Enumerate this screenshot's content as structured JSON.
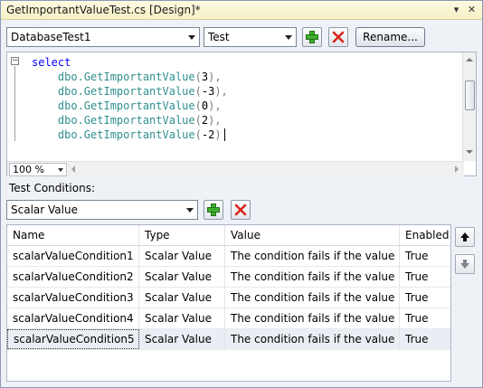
{
  "window": {
    "title": "GetImportantValueTest.cs [Design]*",
    "pin_glyph": "▾",
    "close_glyph": "✕"
  },
  "toolbar": {
    "test_select": "DatabaseTest1",
    "script_select": "Test",
    "rename_label": "Rename..."
  },
  "editor": {
    "lines": [
      {
        "kw": "select",
        "fn": "",
        "open": "",
        "num": "",
        "close": ""
      },
      {
        "kw": "",
        "fn": "dbo.GetImportantValue",
        "open": "(",
        "num": "3",
        "close": "),"
      },
      {
        "kw": "",
        "fn": "dbo.GetImportantValue",
        "open": "(",
        "num": "-3",
        "close": "),"
      },
      {
        "kw": "",
        "fn": "dbo.GetImportantValue",
        "open": "(",
        "num": "0",
        "close": "),"
      },
      {
        "kw": "",
        "fn": "dbo.GetImportantValue",
        "open": "(",
        "num": "2",
        "close": "),"
      },
      {
        "kw": "",
        "fn": "dbo.GetImportantValue",
        "open": "(",
        "num": "-2",
        "close": ")"
      }
    ],
    "outline_glyph": "−",
    "zoom": "100 %"
  },
  "conditions": {
    "label": "Test Conditions:",
    "type_select": "Scalar Value",
    "columns": [
      "Name",
      "Type",
      "Value",
      "Enabled"
    ],
    "rows": [
      {
        "name": "scalarValueCondition1",
        "type": "Scalar Value",
        "value": "The condition fails if the value in...",
        "enabled": "True"
      },
      {
        "name": "scalarValueCondition2",
        "type": "Scalar Value",
        "value": "The condition fails if the value in...",
        "enabled": "True"
      },
      {
        "name": "scalarValueCondition3",
        "type": "Scalar Value",
        "value": "The condition fails if the value in...",
        "enabled": "True"
      },
      {
        "name": "scalarValueCondition4",
        "type": "Scalar Value",
        "value": "The condition fails if the value in...",
        "enabled": "True"
      },
      {
        "name": "scalarValueCondition5",
        "type": "Scalar Value",
        "value": "The condition fails if the value in...",
        "enabled": "True"
      }
    ],
    "selected_row": 4
  },
  "colors": {
    "add": "#3fae2a",
    "delete": "#d9261c",
    "keyword": "#0000ff",
    "function": "#2f8f8f"
  },
  "icons": [
    "pin-icon",
    "close-icon",
    "add-icon",
    "delete-icon",
    "move-up-icon",
    "move-down-icon"
  ]
}
